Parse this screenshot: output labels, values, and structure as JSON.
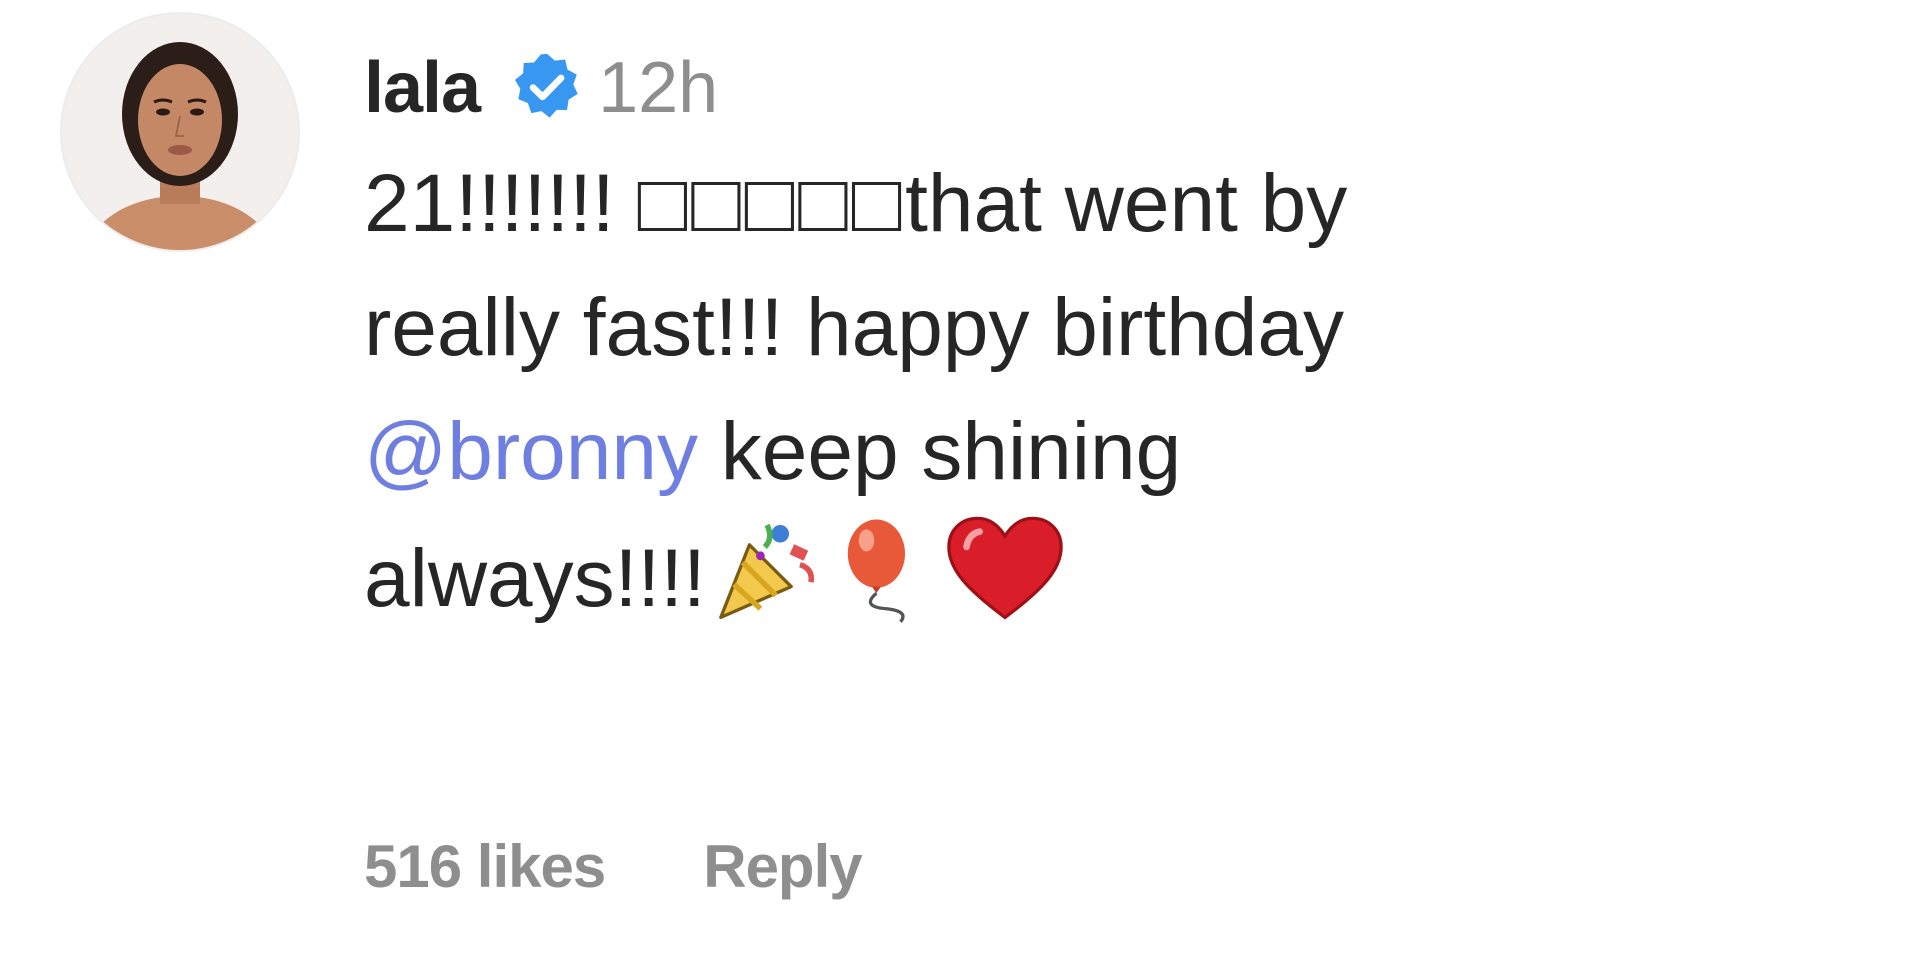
{
  "comment": {
    "username": "lala",
    "verified": true,
    "timestamp": "12h",
    "text_line1_start": "21!!!!!!! ",
    "text_line1_boxes": "□□□□□",
    "text_line1_end": "that went by",
    "text_line2": "really fast!!! happy birthday",
    "mention": "@bronny",
    "text_line3_end": " keep shining",
    "text_line4": "always!!!!",
    "emojis": [
      "party-popper",
      "balloon",
      "red-heart"
    ],
    "likes": "516 likes",
    "reply_label": "Reply"
  },
  "colors": {
    "verified_badge": "#3897f0",
    "mention": "#6e7fe0",
    "secondary_text": "#8e8e8e",
    "primary_text": "#262626"
  }
}
